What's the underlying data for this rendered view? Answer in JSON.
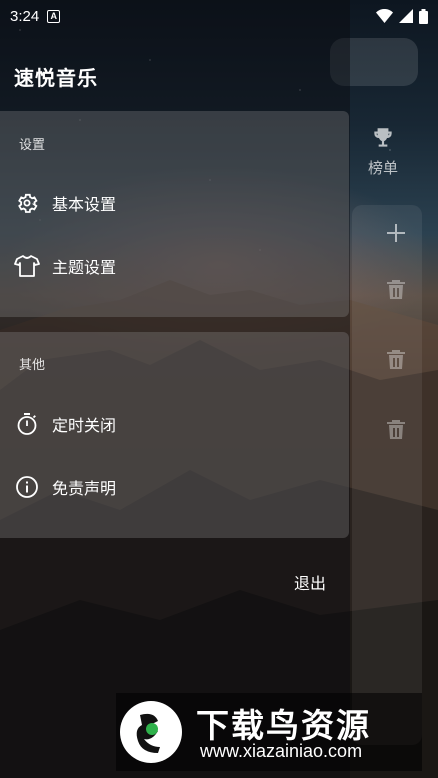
{
  "status_bar": {
    "time": "3:24",
    "notification_badge": "A"
  },
  "drawer": {
    "app_title": "速悦音乐",
    "settings_section": {
      "title": "设置",
      "items": [
        {
          "label": "基本设置",
          "icon": "gear-icon"
        },
        {
          "label": "主题设置",
          "icon": "shirt-icon"
        }
      ]
    },
    "other_section": {
      "title": "其他",
      "items": [
        {
          "label": "定时关闭",
          "icon": "timer-icon"
        },
        {
          "label": "免责声明",
          "icon": "info-icon"
        }
      ]
    },
    "logout_label": "退出"
  },
  "main": {
    "ranking_tab_label": "榜单"
  },
  "watermark": {
    "title": "下载鸟资源",
    "url": "www.xiazainiao.com"
  }
}
